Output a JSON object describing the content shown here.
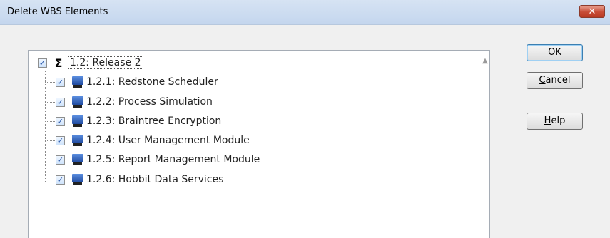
{
  "window": {
    "title": "Delete WBS Elements",
    "close_glyph": "✕"
  },
  "tree": {
    "root": {
      "label": "1.2: Release 2",
      "checked": true,
      "icon": "sigma-icon",
      "symbol": "Σ"
    },
    "children": [
      {
        "label": "1.2.1: Redstone Scheduler",
        "checked": true,
        "icon": "computer-icon"
      },
      {
        "label": "1.2.2: Process Simulation",
        "checked": true,
        "icon": "computer-icon"
      },
      {
        "label": "1.2.3: Braintree Encryption",
        "checked": true,
        "icon": "computer-icon"
      },
      {
        "label": "1.2.4: User Management Module",
        "checked": true,
        "icon": "computer-icon"
      },
      {
        "label": "1.2.5: Report Management Module",
        "checked": true,
        "icon": "computer-icon"
      },
      {
        "label": "1.2.6: Hobbit Data Services",
        "checked": true,
        "icon": "computer-icon"
      }
    ],
    "scroll_up_glyph": "▲"
  },
  "buttons": {
    "ok": {
      "mnemonic": "O",
      "rest": "K"
    },
    "cancel": {
      "mnemonic": "C",
      "rest": "ancel"
    },
    "help": {
      "mnemonic": "H",
      "rest": "elp"
    }
  },
  "check_glyph": "✓"
}
